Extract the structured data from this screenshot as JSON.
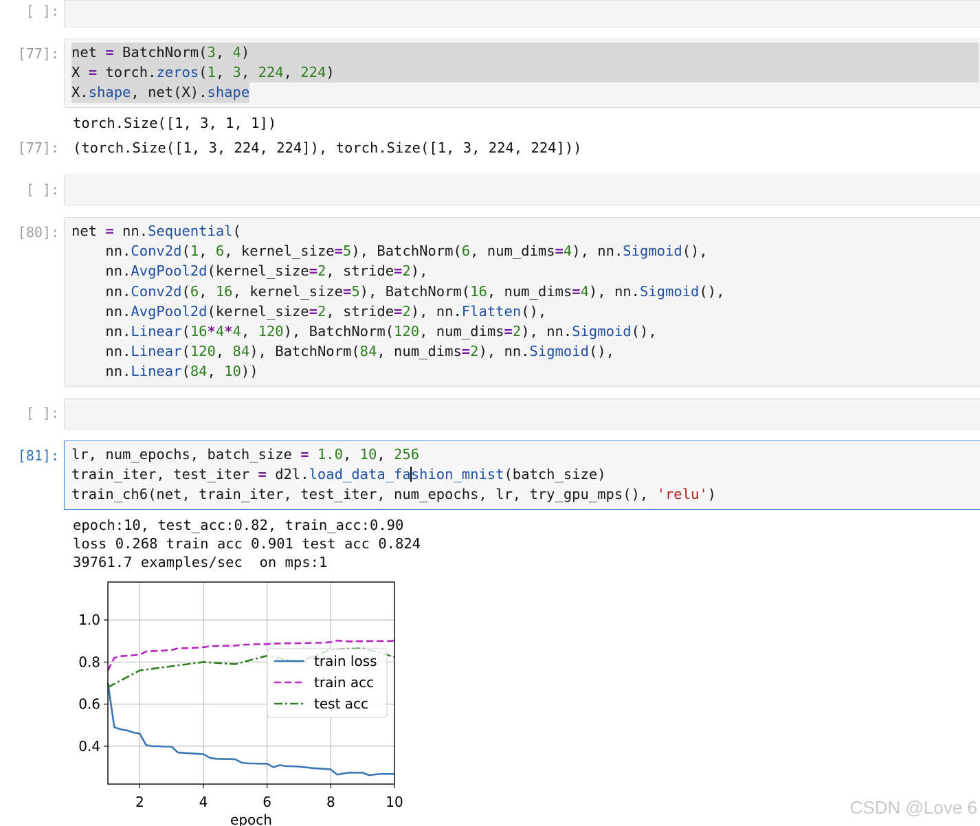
{
  "cells": [
    {
      "prompt": "[ ]:"
    },
    {
      "prompt": "[77]:",
      "output_prompt": "[77]:",
      "stdout": "torch.Size([1, 3, 1, 1])",
      "result": "(torch.Size([1, 3, 224, 224]), torch.Size([1, 3, 224, 224]))"
    },
    {
      "prompt": "[ ]:"
    },
    {
      "prompt": "[80]:"
    },
    {
      "prompt": "[ ]:"
    },
    {
      "prompt": "[81]:",
      "stdout": [
        "epoch:10, test_acc:0.82, train_acc:0.90",
        "loss 0.268 train acc 0.901 test acc 0.824",
        "39761.7 examples/sec  on mps:1"
      ]
    }
  ],
  "watermark": "CSDN @Love 6",
  "chart_data": {
    "type": "line",
    "xlabel": "epoch",
    "ylabel": "",
    "xlim": [
      1,
      10
    ],
    "ylim": [
      0.22,
      1.18
    ],
    "xticks": [
      "2",
      "4",
      "6",
      "8",
      "10"
    ],
    "yticks": [
      "0.4",
      "0.6",
      "0.8",
      "1.0"
    ],
    "grid": true,
    "legend_position": "center-right",
    "series": [
      {
        "name": "train loss",
        "color": "#3a76b4",
        "style": "solid",
        "x": [
          1.0,
          1.2,
          1.4,
          1.6,
          1.8,
          2.0,
          2.2,
          2.4,
          2.6,
          2.8,
          3.0,
          3.2,
          3.4,
          3.6,
          3.8,
          4.0,
          4.2,
          4.4,
          4.6,
          4.8,
          5.0,
          5.2,
          5.4,
          5.6,
          5.8,
          6.0,
          6.2,
          6.4,
          6.6,
          6.8,
          7.0,
          7.2,
          7.4,
          7.6,
          7.8,
          8.0,
          8.2,
          8.4,
          8.6,
          8.8,
          9.0,
          9.2,
          9.4,
          9.6,
          9.8,
          10.0
        ],
        "y": [
          0.7,
          0.49,
          0.48,
          0.475,
          0.465,
          0.46,
          0.405,
          0.4,
          0.4,
          0.398,
          0.398,
          0.37,
          0.368,
          0.366,
          0.364,
          0.362,
          0.345,
          0.34,
          0.339,
          0.339,
          0.338,
          0.322,
          0.318,
          0.318,
          0.317,
          0.317,
          0.3,
          0.31,
          0.305,
          0.305,
          0.303,
          0.3,
          0.296,
          0.294,
          0.292,
          0.29,
          0.265,
          0.27,
          0.275,
          0.274,
          0.274,
          0.262,
          0.266,
          0.268,
          0.268,
          0.268
        ]
      },
      {
        "name": "train acc",
        "color": "#b825c2",
        "style": "dashed",
        "x": [
          1.0,
          1.2,
          1.4,
          1.6,
          1.8,
          2.0,
          2.2,
          2.4,
          2.6,
          2.8,
          3.0,
          3.2,
          3.4,
          3.6,
          3.8,
          4.0,
          4.2,
          4.4,
          4.6,
          4.8,
          5.0,
          5.2,
          5.4,
          5.6,
          5.8,
          6.0,
          6.2,
          6.4,
          6.6,
          6.8,
          7.0,
          7.2,
          7.4,
          7.6,
          7.8,
          8.0,
          8.2,
          8.4,
          8.6,
          8.8,
          9.0,
          9.2,
          9.4,
          9.6,
          9.8,
          10.0
        ],
        "y": [
          0.76,
          0.82,
          0.828,
          0.83,
          0.832,
          0.835,
          0.85,
          0.852,
          0.853,
          0.855,
          0.857,
          0.865,
          0.866,
          0.867,
          0.868,
          0.87,
          0.875,
          0.876,
          0.877,
          0.877,
          0.878,
          0.882,
          0.883,
          0.884,
          0.884,
          0.885,
          0.888,
          0.888,
          0.889,
          0.889,
          0.889,
          0.89,
          0.891,
          0.891,
          0.892,
          0.894,
          0.902,
          0.899,
          0.898,
          0.899,
          0.899,
          0.9,
          0.9,
          0.9,
          0.9,
          0.901
        ]
      },
      {
        "name": "test acc",
        "color": "#2e7d1e",
        "style": "dashdot",
        "x": [
          1,
          2,
          3,
          4,
          5,
          6,
          7,
          8,
          9,
          10
        ],
        "y": [
          0.68,
          0.76,
          0.78,
          0.8,
          0.79,
          0.83,
          0.8,
          0.86,
          0.865,
          0.824
        ]
      }
    ]
  }
}
